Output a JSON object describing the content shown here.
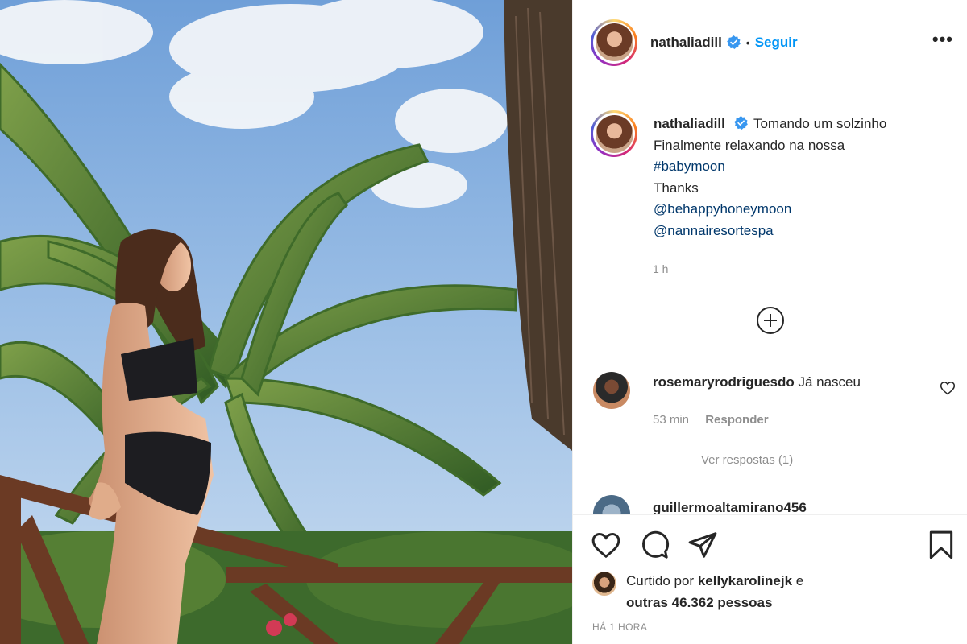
{
  "post": {
    "username": "nathaliadill",
    "separator": "•",
    "follow_label": "Seguir",
    "more_label": "•••",
    "caption": {
      "username": "nathaliadill",
      "line1": "Tomando um solzinho",
      "line2": "Finalmente relaxando na nossa",
      "hashtag": "#babymoon",
      "line3": "Thanks",
      "mention1": "@behappyhoneymoon",
      "mention2": "@nannairesortespa"
    },
    "caption_time": "1 h"
  },
  "comments": [
    {
      "username": "rosemaryrodriguesdo",
      "text": "Já nasceu",
      "time": "53 min",
      "reply_label": "Responder",
      "view_replies": "Ver respostas (1)"
    },
    {
      "username": "guillermoaltamirano456",
      "text": ""
    }
  ],
  "likes": {
    "prefix": "Curtido por",
    "user": "kellykarolinejk",
    "suffix": "e",
    "others_line": "outras 46.362 pessoas"
  },
  "posted_ago": "HÁ 1 HORA",
  "colors": {
    "link_blue": "#0095f6",
    "mention_blue": "#00376b",
    "muted": "#8e8e8e",
    "verified_blue": "#3897f0"
  },
  "icons": [
    "verified-badge-icon",
    "more-options-icon",
    "add-comments-icon",
    "heart-icon",
    "comment-icon",
    "share-icon",
    "bookmark-icon"
  ]
}
